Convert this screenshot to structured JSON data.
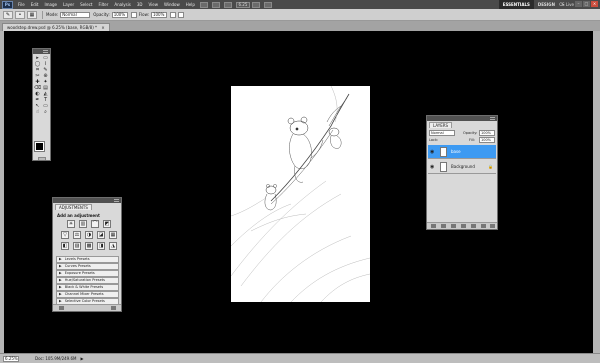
{
  "menubar": {
    "logo": "Ps",
    "items": [
      "File",
      "Edit",
      "Image",
      "Layer",
      "Select",
      "Filter",
      "Analysis",
      "3D",
      "View",
      "Window",
      "Help"
    ],
    "zoom": "6.25",
    "workspaces": [
      "ESSENTIALS",
      "DESIGN"
    ],
    "workspace_more": "»",
    "cs_live": "CS Live",
    "window_controls": [
      "–",
      "□",
      "×"
    ]
  },
  "options": {
    "mode_label": "Mode:",
    "mode_value": "Normal",
    "opacity_label": "Opacity:",
    "opacity_value": "100%",
    "flow_label": "Flow:",
    "flow_value": "100%"
  },
  "document": {
    "tab_title": "woodstep.drew.psd @ 6.25% (base, RGB/8) *",
    "tab_close": "×"
  },
  "status": {
    "zoom": "6.25%",
    "doc_size": "Doc: 105.9M/249.6M",
    "arrow": "▶"
  },
  "tools": {
    "icons": [
      "▸",
      "▭",
      "◯",
      "⌇",
      "⌗",
      "✎",
      "✂",
      "⊕",
      "✚",
      "✦",
      "⌫",
      "▤",
      "◐",
      "◭",
      "✒",
      "T",
      "↖",
      "▭",
      "☝",
      "⌕"
    ]
  },
  "adjustments": {
    "tab": "ADJUSTMENTS",
    "title": "Add an adjustment",
    "row1": [
      "☀",
      "▥",
      "⌒",
      "◩"
    ],
    "row2": [
      "▽",
      "⚖",
      "◑",
      "◪",
      "▦"
    ],
    "row3": [
      "◧",
      "▨",
      "▩",
      "◨",
      "◮"
    ],
    "presets": [
      "Levels Presets",
      "Curves Presets",
      "Exposure Presets",
      "Hue/Saturation Presets",
      "Black & White Presets",
      "Channel Mixer Presets",
      "Selective Color Presets"
    ]
  },
  "layers": {
    "tab": "LAYERS",
    "blend_mode": "Normal",
    "opacity_label": "Opacity:",
    "opacity_value": "100%",
    "lock_label": "Lock:",
    "fill_label": "Fill:",
    "fill_value": "100%",
    "rows": [
      {
        "name": "base",
        "selected": true
      },
      {
        "name": "Background",
        "selected": false
      }
    ],
    "eye": "◉",
    "lock_icon": "🔒"
  },
  "colors": {
    "menubar": "#4a4a4a",
    "canvas_bg": "#000000",
    "selected_layer": "#3d9af2",
    "foreground": "#000000",
    "background": "#ffffff"
  }
}
